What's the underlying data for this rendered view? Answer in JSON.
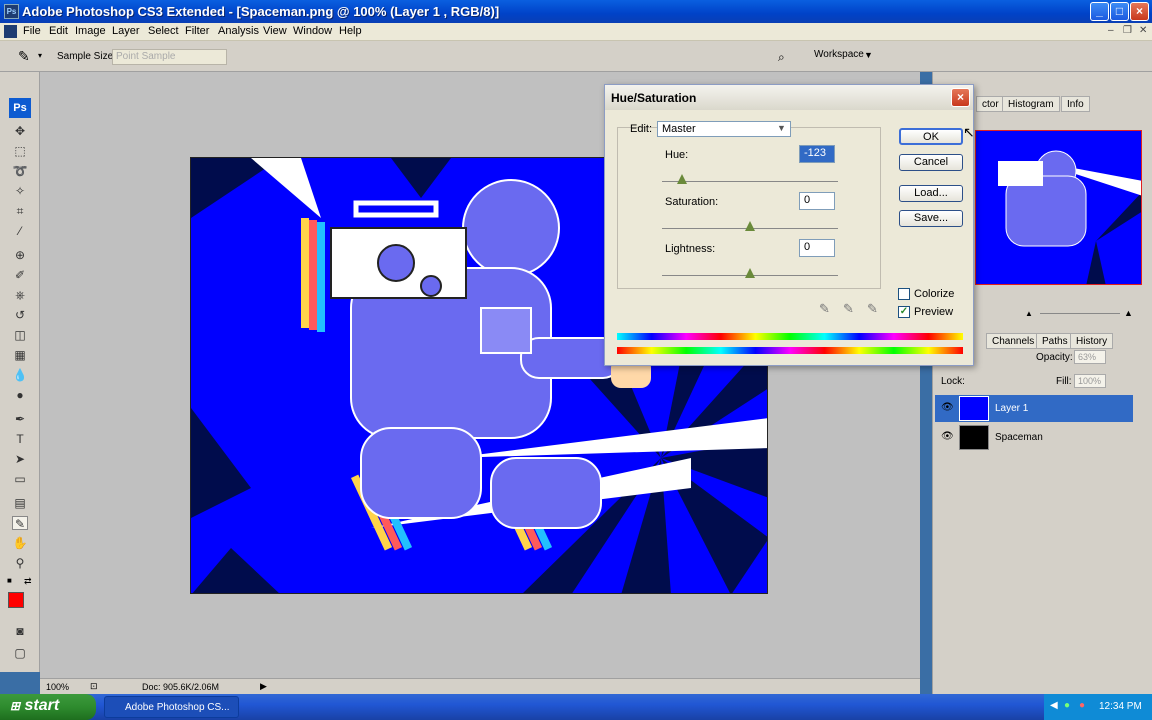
{
  "window": {
    "title": "Adobe Photoshop CS3 Extended - [Spaceman.png @ 100% (Layer 1 , RGB/8)]",
    "logo_text": "Ps"
  },
  "menu": [
    "File",
    "Edit",
    "Image",
    "Layer",
    "Select",
    "Filter",
    "Analysis",
    "View",
    "Window",
    "Help"
  ],
  "options_bar": {
    "sample_size_label": "Sample Size:",
    "sample_size_value": "Point Sample",
    "workspace_label": "Workspace"
  },
  "toolbox": {
    "logo_text": "Ps",
    "foreground_color": "#ff0000"
  },
  "status_bar": {
    "zoom": "100%",
    "doc_info": "Doc: 905.6K/2.06M"
  },
  "right_panels": {
    "top_tabs": [
      "Histogram",
      "Info"
    ],
    "top_tab_partial": "ctor",
    "layer_tabs": [
      "Channels",
      "Paths",
      "History"
    ],
    "opacity_label": "Opacity:",
    "opacity_value": "63%",
    "lock_label": "Lock:",
    "fill_label": "Fill:",
    "fill_value": "100%",
    "layers": [
      {
        "name": "Layer 1",
        "selected": true
      },
      {
        "name": "Spaceman",
        "selected": false
      }
    ]
  },
  "dialog": {
    "title": "Hue/Saturation",
    "edit_label": "Edit:",
    "edit_value": "Master",
    "hue_label": "Hue:",
    "hue_value": "-123",
    "saturation_label": "Saturation:",
    "saturation_value": "0",
    "lightness_label": "Lightness:",
    "lightness_value": "0",
    "buttons": {
      "ok": "OK",
      "cancel": "Cancel",
      "load": "Load...",
      "save": "Save..."
    },
    "colorize_label": "Colorize",
    "colorize_checked": false,
    "preview_label": "Preview",
    "preview_checked": true
  },
  "taskbar": {
    "start_label": "start",
    "task_item": "Adobe Photoshop CS...",
    "clock": "12:34 PM"
  },
  "colors": {
    "canvas_bg": "#0000ff",
    "canvas_dark": "#000c4c",
    "figure": "#6a6af0",
    "selected_layer": "#316ac5"
  }
}
